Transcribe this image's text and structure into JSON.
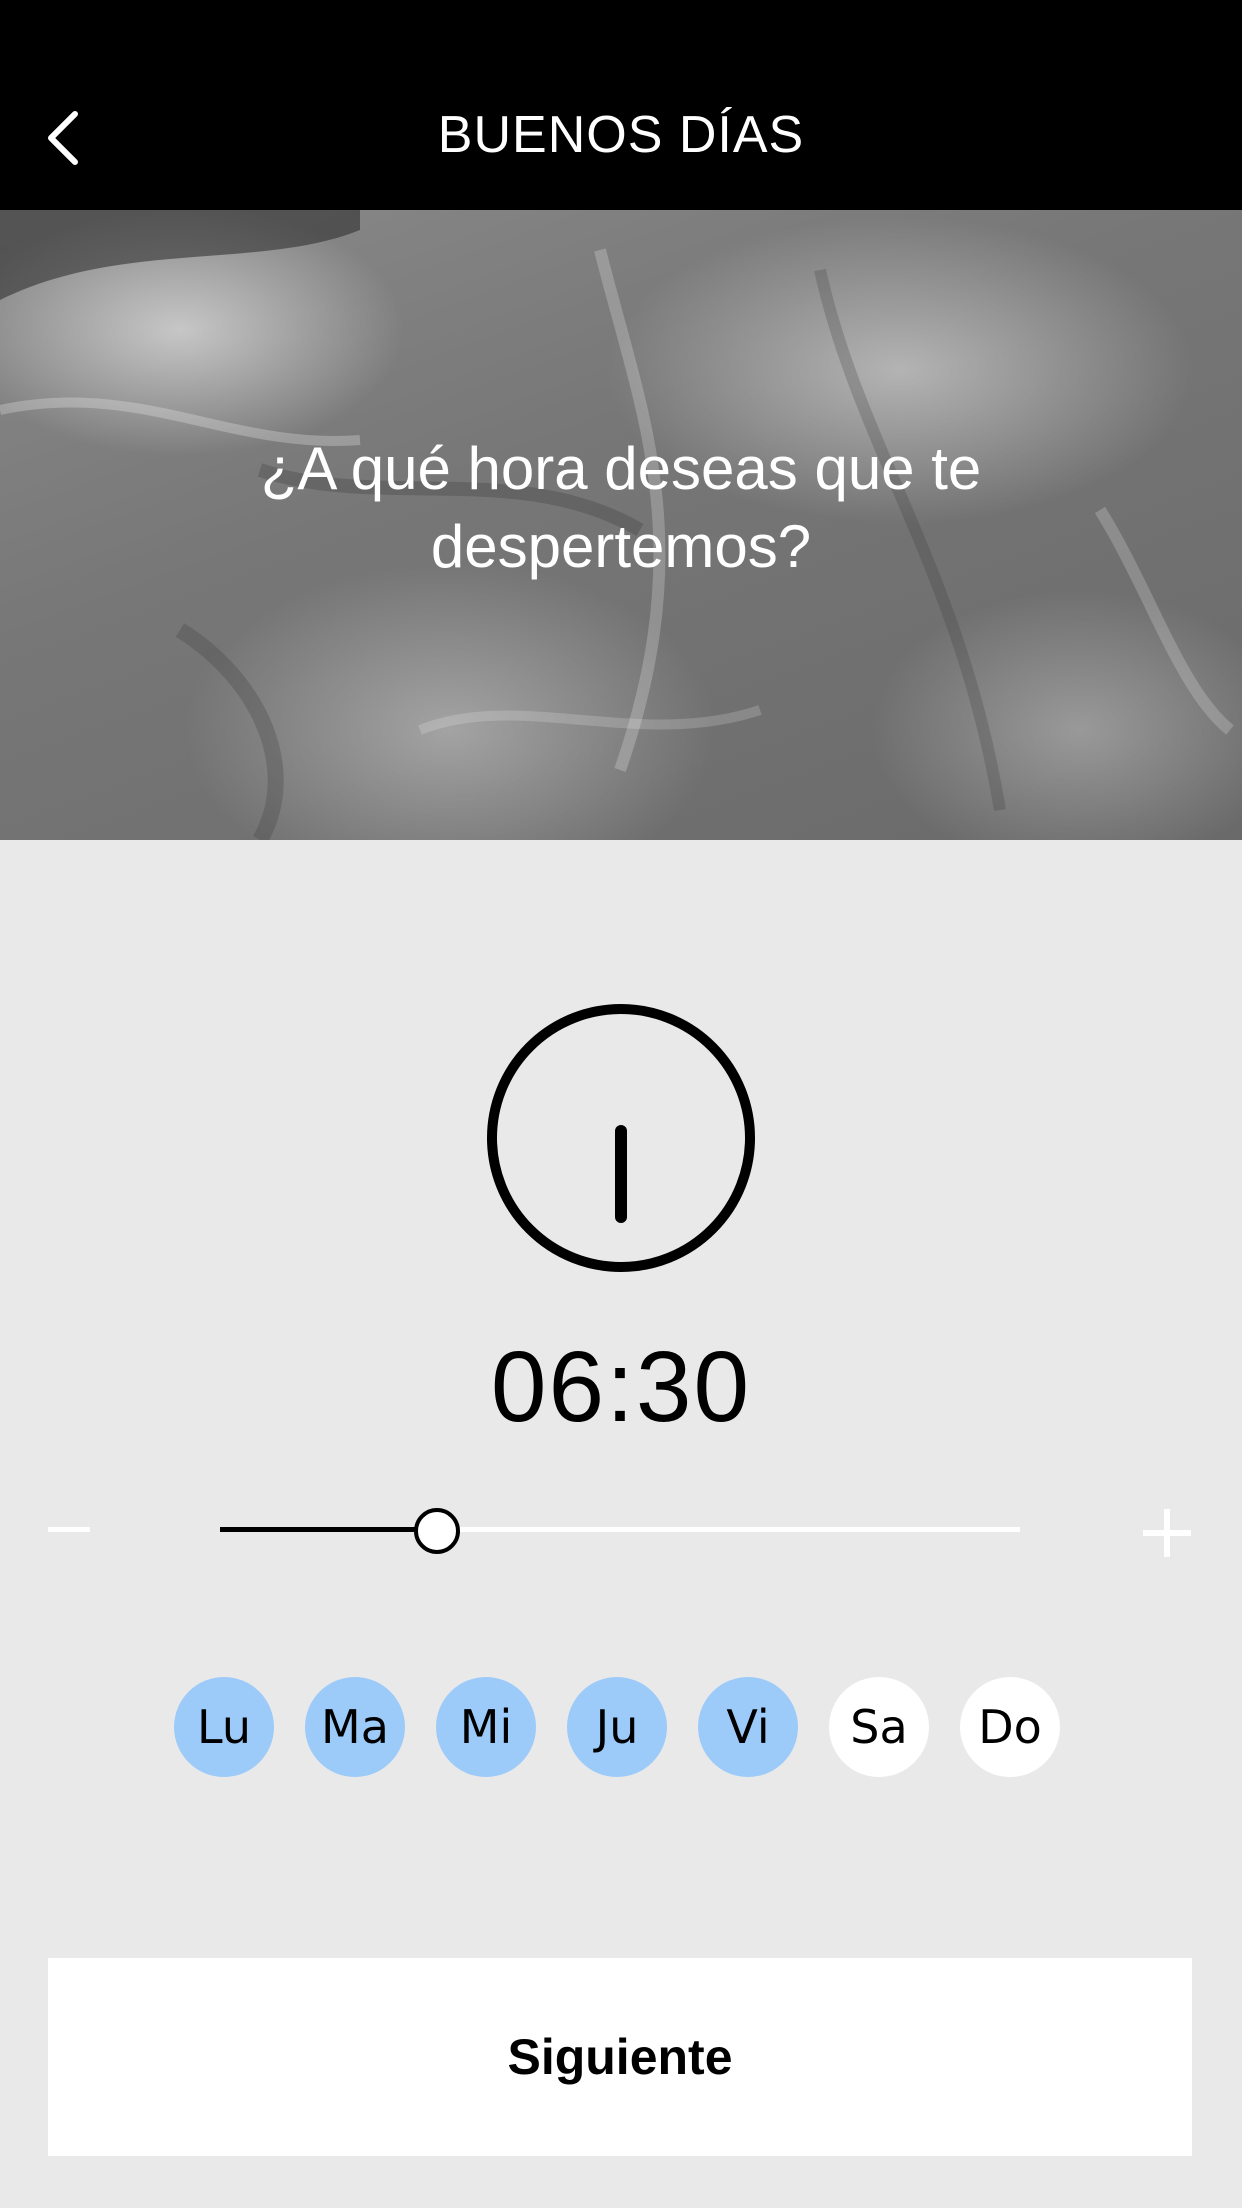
{
  "header": {
    "title": "BUENOS DÍAS",
    "back_icon": "chevron-left-icon"
  },
  "hero": {
    "question": "¿A qué hora deseas que te despertemos?"
  },
  "alarm": {
    "time": "06:30",
    "clock_icon": "clock-icon",
    "minus_label": "−",
    "plus_label": "+",
    "slider_fraction": 0.27
  },
  "days": [
    {
      "label": "Lu",
      "selected": true
    },
    {
      "label": "Ma",
      "selected": true
    },
    {
      "label": "Mi",
      "selected": true
    },
    {
      "label": "Ju",
      "selected": true
    },
    {
      "label": "Vi",
      "selected": true
    },
    {
      "label": "Sa",
      "selected": false
    },
    {
      "label": "Do",
      "selected": false
    }
  ],
  "colors": {
    "header_bg": "#000000",
    "page_bg": "#e9e9e9",
    "day_selected": "#9ccbf9",
    "day_unselected": "#ffffff"
  },
  "footer": {
    "next_label": "Siguiente"
  }
}
